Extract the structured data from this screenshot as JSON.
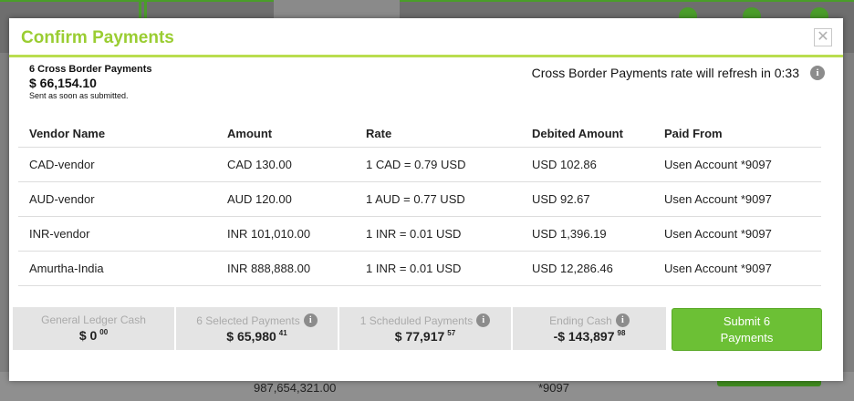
{
  "background": {
    "bottom_amount": "987,654,321.00",
    "bottom_account": "*9097"
  },
  "modal": {
    "title": "Confirm Payments",
    "close_symbol": "✕"
  },
  "summary": {
    "count": "6 Cross Border Payments",
    "amount": "$ 66,154.10",
    "note": "Sent as soon as submitted."
  },
  "refresh": {
    "text": "Cross Border Payments rate will refresh in 0:33",
    "icon": "info-icon"
  },
  "table": {
    "headers": [
      "Vendor Name",
      "Amount",
      "Rate",
      "Debited Amount",
      "Paid From"
    ],
    "rows": [
      [
        "CAD-vendor",
        "CAD 130.00",
        "1 CAD = 0.79 USD",
        "USD 102.86",
        "Usen Account *9097"
      ],
      [
        "AUD-vendor",
        "AUD 120.00",
        "1 AUD = 0.77 USD",
        "USD 92.67",
        "Usen Account *9097"
      ],
      [
        "INR-vendor",
        "INR 101,010.00",
        "1 INR = 0.01 USD",
        "USD 1,396.19",
        "Usen Account *9097"
      ],
      [
        "Amurtha-India",
        "INR 888,888.00",
        "1 INR = 0.01 USD",
        "USD 12,286.46",
        "Usen Account *9097"
      ]
    ]
  },
  "footer": {
    "gl_cash": {
      "label": "General Ledger Cash",
      "value": "$ 0",
      "cents": "00"
    },
    "selected": {
      "label": "6 Selected Payments",
      "value": "$ 65,980",
      "cents": "41"
    },
    "scheduled": {
      "label": "1 Scheduled Payments",
      "value": "$ 77,917",
      "cents": "57"
    },
    "ending": {
      "label": "Ending Cash",
      "value": "-$ 143,897",
      "cents": "98"
    },
    "submit_label": "Submit 6 Payments"
  },
  "colors": {
    "title": "#9acd32",
    "submit": "#6cc035",
    "accent_line": "#b9dd4f"
  }
}
